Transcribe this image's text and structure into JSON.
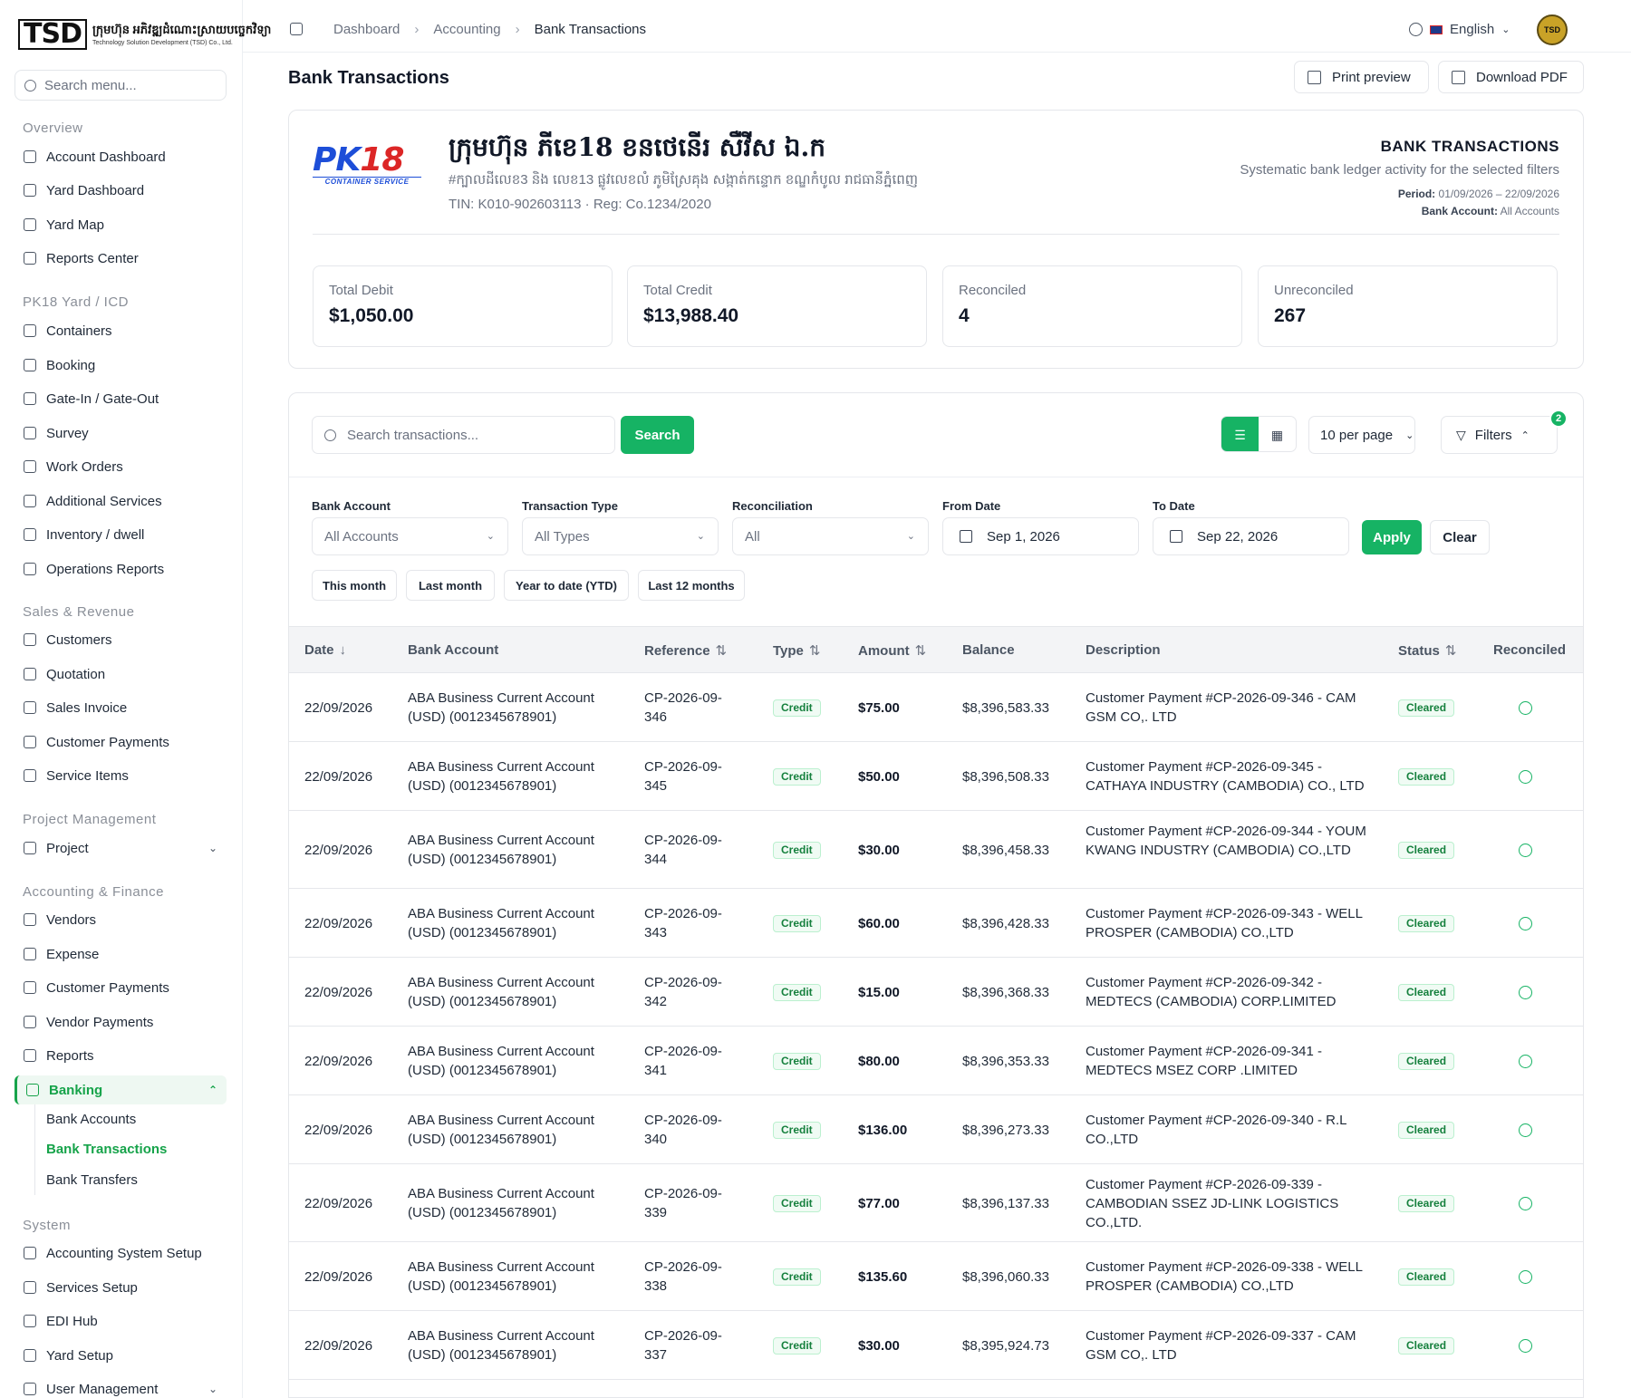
{
  "brand": {
    "logo_mark": "TSD",
    "name_khmer": "ក្រុមហ៊ុន អភិវឌ្ឍដំណោះស្រាយបច្ចេកវិទ្យា",
    "name_english": "Technology Solution Development (TSD) Co., Ltd."
  },
  "sidebar": {
    "search_placeholder": "Search menu...",
    "sections": {
      "overview": "Overview",
      "yard": "PK18 Yard / ICD",
      "sales": "Sales & Revenue",
      "project": "Project Management",
      "accounting": "Accounting & Finance",
      "system": "System"
    },
    "items": {
      "account_dashboard": "Account Dashboard",
      "yard_dashboard": "Yard Dashboard",
      "yard_map": "Yard Map",
      "reports_center": "Reports Center",
      "containers": "Containers",
      "booking": "Booking",
      "gate": "Gate-In / Gate-Out",
      "survey": "Survey",
      "work_orders": "Work Orders",
      "additional_services": "Additional Services",
      "inventory": "Inventory / dwell",
      "operations_reports": "Operations Reports",
      "customers": "Customers",
      "quotation": "Quotation",
      "sales_invoice": "Sales Invoice",
      "customer_payments_sales": "Customer Payments",
      "service_items": "Service Items",
      "project": "Project",
      "vendors": "Vendors",
      "expense": "Expense",
      "customer_payments_acc": "Customer Payments",
      "vendor_payments": "Vendor Payments",
      "reports": "Reports",
      "banking": "Banking",
      "bank_accounts": "Bank Accounts",
      "bank_transactions": "Bank Transactions",
      "bank_transfers": "Bank Transfers",
      "accounting_system_setup": "Accounting System Setup",
      "services_setup": "Services Setup",
      "edi_hub": "EDI Hub",
      "yard_setup": "Yard Setup",
      "user_management": "User Management"
    }
  },
  "topbar": {
    "breadcrumbs": [
      "Dashboard",
      "Accounting",
      "Bank Transactions"
    ],
    "language": "English",
    "avatar": "TSD"
  },
  "page": {
    "title": "Bank Transactions",
    "print_preview": "Print preview",
    "download_pdf": "Download PDF"
  },
  "report": {
    "logo_pk": "PK",
    "logo_18": "18",
    "logo_sub": "CONTAINER SERVICE",
    "company_name": "ក្រុមហ៊ុន ភីខេ18 ខនថេនើរ សឺវីស ឯ.ក",
    "company_address": "#ក្បាលដីលេខ3 និង លេខ13 ផ្លូវលេខលំ ភូមិស្រែគុង សង្កាត់កន្ទោក ខណ្ឌកំបូល រាជធានីភ្នំពេញ",
    "tin_reg": "TIN: K010-902603113 · Reg: Co.1234/2020",
    "title": "BANK TRANSACTIONS",
    "subtitle": "Systematic bank ledger activity for the selected filters",
    "period_label": "Period:",
    "period_value": "01/09/2026 – 22/09/2026",
    "account_label": "Bank Account:",
    "account_value": "All Accounts",
    "kpis": {
      "total_debit_label": "Total Debit",
      "total_debit": "$1,050.00",
      "total_credit_label": "Total Credit",
      "total_credit": "$13,988.40",
      "reconciled_label": "Reconciled",
      "reconciled": "4",
      "unreconciled_label": "Unreconciled",
      "unreconciled": "267"
    }
  },
  "toolbar": {
    "search_placeholder": "Search transactions...",
    "search_button": "Search",
    "per_page": "10 per page",
    "filters": "Filters",
    "filter_count": "2"
  },
  "filters": {
    "bank_account_label": "Bank Account",
    "bank_account_value": "All Accounts",
    "type_label": "Transaction Type",
    "type_value": "All Types",
    "recon_label": "Reconciliation",
    "recon_value": "All",
    "from_label": "From Date",
    "from_value": "Sep 1, 2026",
    "to_label": "To Date",
    "to_value": "Sep 22, 2026",
    "apply": "Apply",
    "clear": "Clear",
    "presets": [
      "This month",
      "Last month",
      "Year to date (YTD)",
      "Last 12 months"
    ]
  },
  "table": {
    "headers": {
      "date": "Date",
      "bank_account": "Bank Account",
      "reference": "Reference",
      "type": "Type",
      "amount": "Amount",
      "balance": "Balance",
      "description": "Description",
      "status": "Status",
      "reconciled": "Reconciled"
    },
    "rows": [
      {
        "date": "22/09/2026",
        "account": "ABA Business Current Account (USD) (0012345678901)",
        "reference": "CP-2026-09-346",
        "type": "Credit",
        "amount": "$75.00",
        "balance": "$8,396,583.33",
        "description": "Customer Payment #CP-2026-09-346 - CAM GSM CO,. LTD",
        "status": "Cleared"
      },
      {
        "date": "22/09/2026",
        "account": "ABA Business Current Account (USD) (0012345678901)",
        "reference": "CP-2026-09-345",
        "type": "Credit",
        "amount": "$50.00",
        "balance": "$8,396,508.33",
        "description": "Customer Payment #CP-2026-09-345 - CATHAYA INDUSTRY (CAMBODIA) CO., LTD",
        "status": "Cleared"
      },
      {
        "date": "22/09/2026",
        "account": "ABA Business Current Account (USD) (0012345678901)",
        "reference": "CP-2026-09-344",
        "type": "Credit",
        "amount": "$30.00",
        "balance": "$8,396,458.33",
        "description": "Customer Payment #CP-2026-09-344 - YOUM KWANG INDUSTRY (CAMBODIA) CO.,LTD",
        "status": "Cleared"
      },
      {
        "date": "22/09/2026",
        "account": "ABA Business Current Account (USD) (0012345678901)",
        "reference": "CP-2026-09-343",
        "type": "Credit",
        "amount": "$60.00",
        "balance": "$8,396,428.33",
        "description": "Customer Payment #CP-2026-09-343 - WELL PROSPER (CAMBODIA) CO.,LTD",
        "status": "Cleared"
      },
      {
        "date": "22/09/2026",
        "account": "ABA Business Current Account (USD) (0012345678901)",
        "reference": "CP-2026-09-342",
        "type": "Credit",
        "amount": "$15.00",
        "balance": "$8,396,368.33",
        "description": "Customer Payment #CP-2026-09-342 - MEDTECS (CAMBODIA) CORP.LIMITED",
        "status": "Cleared"
      },
      {
        "date": "22/09/2026",
        "account": "ABA Business Current Account (USD) (0012345678901)",
        "reference": "CP-2026-09-341",
        "type": "Credit",
        "amount": "$80.00",
        "balance": "$8,396,353.33",
        "description": "Customer Payment #CP-2026-09-341 - MEDTECS MSEZ CORP .LIMITED",
        "status": "Cleared"
      },
      {
        "date": "22/09/2026",
        "account": "ABA Business Current Account (USD) (0012345678901)",
        "reference": "CP-2026-09-340",
        "type": "Credit",
        "amount": "$136.00",
        "balance": "$8,396,273.33",
        "description": "Customer Payment #CP-2026-09-340 - R.L CO.,LTD",
        "status": "Cleared"
      },
      {
        "date": "22/09/2026",
        "account": "ABA Business Current Account (USD) (0012345678901)",
        "reference": "CP-2026-09-339",
        "type": "Credit",
        "amount": "$77.00",
        "balance": "$8,396,137.33",
        "description": "Customer Payment #CP-2026-09-339 - CAMBODIAN SSEZ JD-LINK LOGISTICS CO.,LTD.",
        "status": "Cleared"
      },
      {
        "date": "22/09/2026",
        "account": "ABA Business Current Account (USD) (0012345678901)",
        "reference": "CP-2026-09-338",
        "type": "Credit",
        "amount": "$135.60",
        "balance": "$8,396,060.33",
        "description": "Customer Payment #CP-2026-09-338 - WELL PROSPER (CAMBODIA) CO.,LTD",
        "status": "Cleared"
      },
      {
        "date": "22/09/2026",
        "account": "ABA Business Current Account (USD) (0012345678901)",
        "reference": "CP-2026-09-337",
        "type": "Credit",
        "amount": "$30.00",
        "balance": "$8,395,924.73",
        "description": "Customer Payment #CP-2026-09-337 - CAM GSM CO,. LTD",
        "status": "Cleared"
      }
    ]
  },
  "colors": {
    "accent": "#16b364",
    "active_text": "#16a34a",
    "pk_blue": "#1d4ed8",
    "pk_red": "#dc2626"
  }
}
